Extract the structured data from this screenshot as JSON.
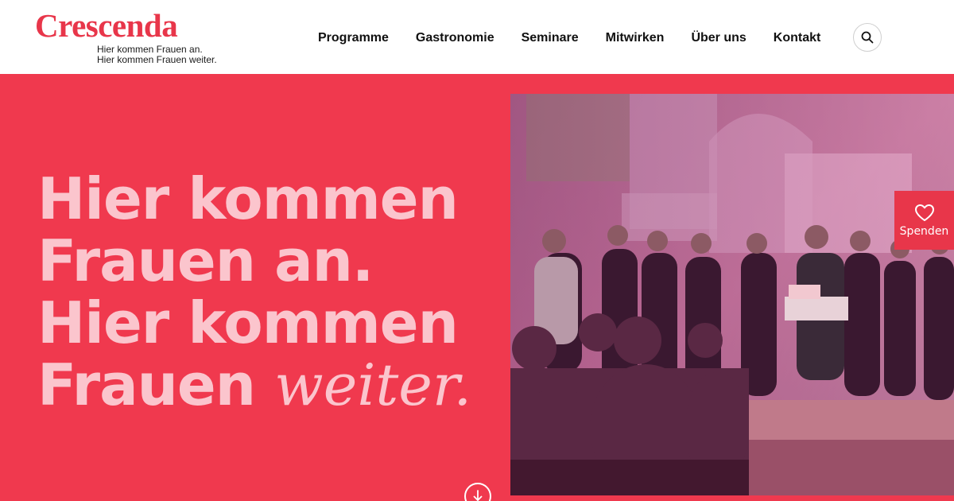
{
  "header": {
    "logo_text": "Crescenda",
    "tagline_1": "Hier kommen Frauen an.",
    "tagline_2": "Hier kommen Frauen weiter.",
    "nav": [
      "Programme",
      "Gastronomie",
      "Seminare",
      "Mitwirken",
      "Über uns",
      "Kontakt"
    ],
    "search_icon": "search-icon"
  },
  "hero": {
    "line_1": "Hier kommen",
    "line_2": "Frauen an.",
    "line_3": "Hier kommen",
    "line_4_a": "Frauen ",
    "line_4_b": "weiter.",
    "scroll_icon": "arrow-down-circle-icon"
  },
  "donate": {
    "label": "Spenden",
    "icon": "heart-icon"
  },
  "colors": {
    "brand_red": "#e8364a",
    "hero_bg": "#f0394e",
    "headline_pink": "#fbc5cd"
  }
}
